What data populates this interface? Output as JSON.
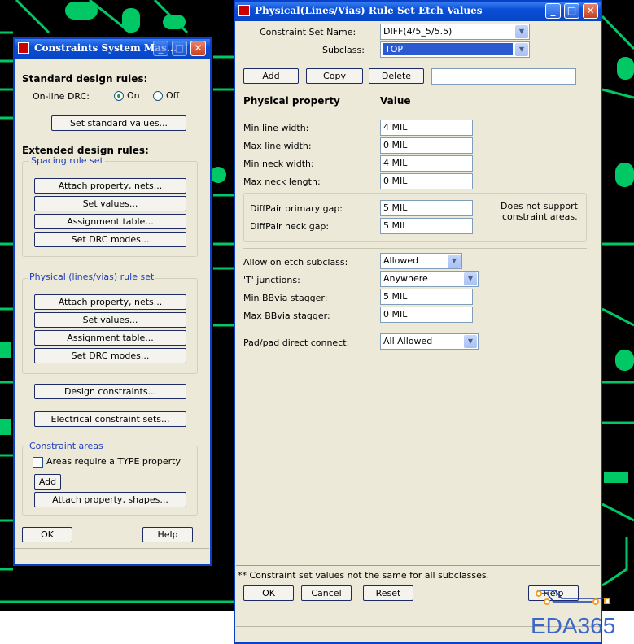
{
  "colors": {
    "titlebar": "#0a4fd6",
    "pcb_bg": "#000000",
    "trace": "#00c864",
    "window_bg": "#ece9d8"
  },
  "watermark": "EDA365",
  "csm": {
    "title": "Constraints System Mas...",
    "standard_heading": "Standard design rules:",
    "online_drc_label": "On-line DRC:",
    "on_label": "On",
    "off_label": "Off",
    "online_drc_selected": "On",
    "set_standard_label": "Set standard values...",
    "extended_heading": "Extended design rules:",
    "spacing_group": "Spacing rule set",
    "spacing_buttons": [
      "Attach property, nets...",
      "Set values...",
      "Assignment table...",
      "Set DRC modes..."
    ],
    "physical_group": "Physical (lines/vias) rule set",
    "physical_buttons": [
      "Attach property, nets...",
      "Set values...",
      "Assignment table...",
      "Set DRC modes..."
    ],
    "design_constraints_label": "Design constraints...",
    "electrical_sets_label": "Electrical constraint sets...",
    "areas_group": "Constraint areas",
    "areas_checkbox_label": "Areas require a TYPE property",
    "areas_checked": false,
    "add_label": "Add",
    "attach_shapes_label": "Attach property, shapes...",
    "ok_label": "OK",
    "help_label": "Help"
  },
  "phys": {
    "title": "Physical(Lines/Vias) Rule Set Etch Values",
    "constraint_set_label": "Constraint Set Name:",
    "constraint_set_value": "DIFF(4/5_5/5.5)",
    "subclass_label": "Subclass:",
    "subclass_value": "TOP",
    "add_label": "Add",
    "copy_label": "Copy",
    "delete_label": "Delete",
    "name_input_value": "",
    "header_property": "Physical property",
    "header_value": "Value",
    "rows1": [
      {
        "label": "Min line width:",
        "value": "4 MIL"
      },
      {
        "label": "Max line width:",
        "value": "0 MIL"
      },
      {
        "label": "Min neck width:",
        "value": "4 MIL"
      },
      {
        "label": "Max neck length:",
        "value": "0 MIL"
      }
    ],
    "diff_rows": [
      {
        "label": "DiffPair primary gap:",
        "value": "5 MIL"
      },
      {
        "label": "DiffPair neck gap:",
        "value": "5 MIL"
      }
    ],
    "diff_note_line1": "Does not support",
    "diff_note_line2": "constraint areas.",
    "allow_label": "Allow on etch subclass:",
    "allow_value": "Allowed",
    "t_label": "'T' junctions:",
    "t_value": "Anywhere",
    "min_bb_label": "Min BBvia stagger:",
    "min_bb_value": "5 MIL",
    "max_bb_label": "Max BBvia stagger:",
    "max_bb_value": "0 MIL",
    "pad_label": "Pad/pad direct connect:",
    "pad_value": "All Allowed",
    "footnote": "** Constraint set values not the same for all subclasses.",
    "ok_label": "OK",
    "cancel_label": "Cancel",
    "reset_label": "Reset",
    "help_label": "Help"
  }
}
